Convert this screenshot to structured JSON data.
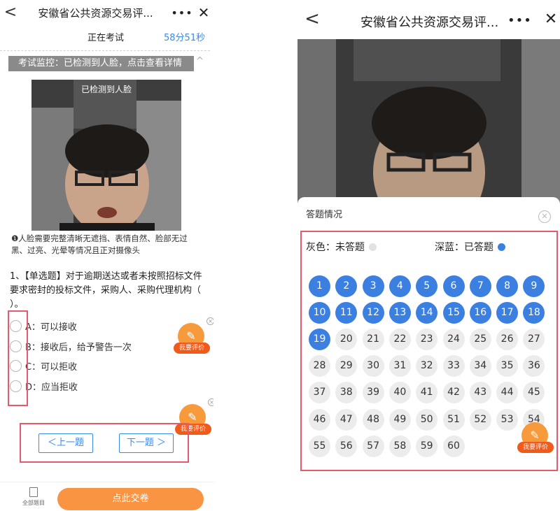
{
  "left": {
    "title": "安徽省公共资源交易评...",
    "more_icon": "•••",
    "close_icon": "✕",
    "back_icon": "<",
    "status": "正在考试",
    "timer": "58分51秒",
    "monitor": "考试监控：已检测到人脸，点击查看详情",
    "monitor_caret": "^",
    "video_label": "已检测到人脸",
    "notice": "❶人脸需要完整清晰无遮挡、表情自然、脸部无过黑、过亮、光晕等情况且正对摄像头",
    "question": "1、【单选题】对于逾期送达或者未按照招标文件要求密封的投标文件，采购人、采购代理机构（ ）。",
    "options": [
      {
        "label": "A：可以接收"
      },
      {
        "label": "B：接收后，给予警告一次"
      },
      {
        "label": "C：可以拒收"
      },
      {
        "label": "D：应当拒收"
      }
    ],
    "prev": "＜上一题",
    "next": "下一题 ＞",
    "all_questions": "全部题目",
    "submit": "点此交卷",
    "fab_label": "我要评价",
    "fab_label_partial": "我要评价"
  },
  "right": {
    "title": "安徽省公共资源交易评...",
    "more_icon": "•••",
    "close_icon": "✕",
    "back_icon": "<",
    "sheet_title": "答题情况",
    "sheet_close": "✕",
    "legend_unanswered": "灰色：未答题",
    "legend_answered": "深蓝：已答题",
    "fab_label": "我要评价",
    "answered_count": 19,
    "total": 60
  },
  "colors": {
    "accent": "#3b8ae6",
    "answered": "#3b7fe0",
    "unanswered": "#ececec",
    "submit": "#f99442",
    "highlight_box": "#e85a6a"
  }
}
